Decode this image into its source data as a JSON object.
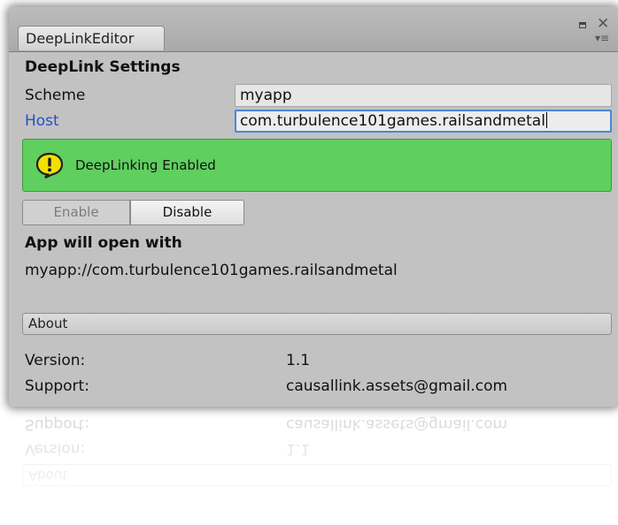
{
  "window": {
    "tab_title": "DeepLinkEditor",
    "close_glyph": "✕",
    "menu_glyph": "▾≡"
  },
  "settings": {
    "heading": "DeepLink Settings",
    "scheme": {
      "label": "Scheme",
      "value": "myapp"
    },
    "host": {
      "label": "Host",
      "value": "com.turbulence101games.railsandmetal"
    }
  },
  "status": {
    "message": "DeepLinking Enabled",
    "icon": "info-icon",
    "color": "#5fcf5f"
  },
  "buttons": {
    "enable_label": "Enable",
    "disable_label": "Disable"
  },
  "open_with": {
    "heading": "App will open with",
    "url": "myapp://com.turbulence101games.railsandmetal"
  },
  "about": {
    "header": "About",
    "version_label": "Version:",
    "version_value": "1.1",
    "support_label": "Support:",
    "support_value": "causallink.assets@gmail.com"
  },
  "colors": {
    "accent_focus": "#4d84d6",
    "host_label": "#2450c8",
    "panel_bg": "#c2c2c2"
  }
}
